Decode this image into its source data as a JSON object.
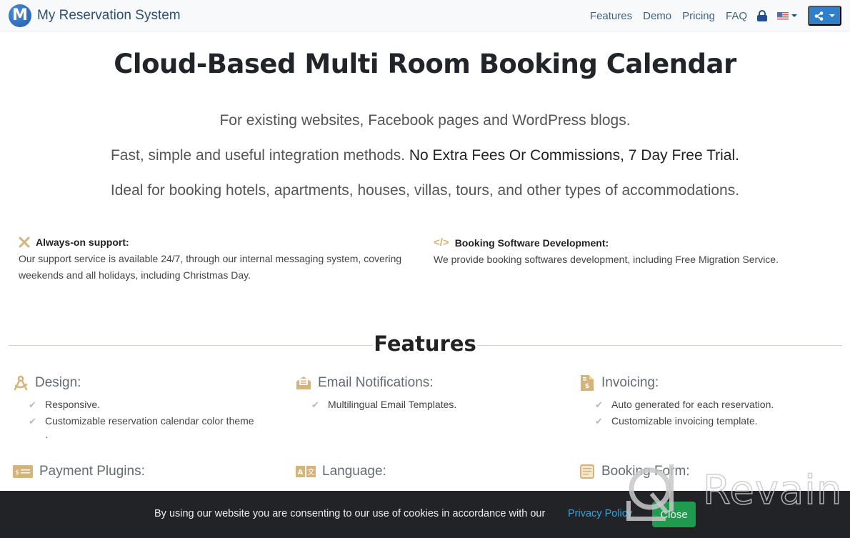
{
  "navbar": {
    "brand_logo_letter": "M",
    "brand_name": "My Reservation System",
    "links": [
      {
        "label": "Features"
      },
      {
        "label": "Demo"
      },
      {
        "label": "Pricing"
      },
      {
        "label": "FAQ"
      }
    ],
    "lock_icon": "lock-icon",
    "language_flag": "us-flag-icon",
    "share_icon": "share-icon"
  },
  "hero": {
    "title": "Cloud-Based Multi Room Booking Calendar",
    "lead1": "For existing websites, Facebook pages and WordPress blogs.",
    "lead2_normal": "Fast, simple and useful integration methods. ",
    "lead2_strong": "No Extra Fees Or Commissions, 7 Day Free Trial.",
    "lead3": "Ideal for booking hotels, apartments, houses, villas, tours, and other types of accommodations."
  },
  "info": {
    "support": {
      "icon": "tools-icon",
      "title": "Always-on support:",
      "text": "Our support service is available 24/7, through our internal messaging system, covering weekends and all holidays, including Christmas Day."
    },
    "development": {
      "icon": "code-icon",
      "title": "Booking Software Development:",
      "text": "We provide booking softwares development, including Free Migration Service."
    }
  },
  "features": {
    "heading": "Features",
    "accent_color": "#d4b47a",
    "blocks": [
      {
        "title": "Design:",
        "icon": "compass-drafting-icon",
        "items": [
          "Responsive.",
          "Customizable reservation calendar color theme"
        ],
        "trailing": "."
      },
      {
        "title": "Email Notifications:",
        "icon": "envelope-open-icon",
        "items": [
          "Multilingual Email Templates."
        ]
      },
      {
        "title": "Invoicing:",
        "icon": "invoice-dollar-icon",
        "items": [
          "Auto generated for each reservation.",
          "Customizable invoicing template."
        ]
      },
      {
        "title": "Payment Plugins:",
        "icon": "money-check-icon",
        "items": []
      },
      {
        "title": "Language:",
        "icon": "language-icon",
        "items": []
      },
      {
        "title": "Booking Form:",
        "icon": "form-icon",
        "items": []
      }
    ]
  },
  "cookie_bar": {
    "text": "By using our website you are consenting to our use of cookies in accordance with our",
    "link": "Privacy Policy",
    "close": "Close"
  },
  "watermark": {
    "text": "Revain"
  }
}
